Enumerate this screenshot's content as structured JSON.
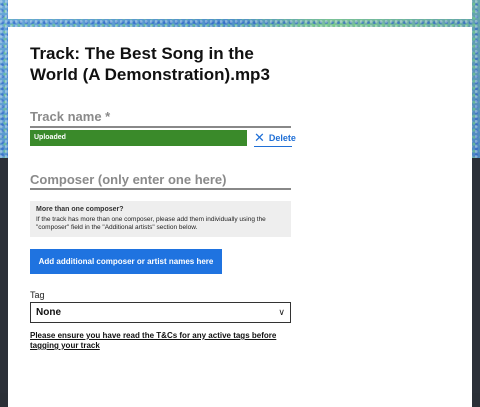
{
  "form": {
    "title": "Track: The Best Song in the World (A Demonstration).mp3",
    "track_name_label": "Track name *",
    "uploaded_status": "Uploaded",
    "delete_label": "Delete",
    "delete_icon": "close-icon",
    "composer_label": "Composer (only enter one here)",
    "info_box": {
      "heading": "More than one composer?",
      "body": "If the track has more than one composer, please add them individually using the \"composer\" field in the \"Additional artists\" section below."
    },
    "add_button_label": "Add additional composer or artist names here",
    "tag_label": "Tag",
    "tag_value": "None",
    "tag_icon": "chevron-down-icon",
    "terms_link": "Please ensure you have read the T&Cs for any active tags before tagging your track"
  },
  "colors": {
    "uploaded": "#3a8a2a",
    "accent_blue": "#1f73e0"
  }
}
